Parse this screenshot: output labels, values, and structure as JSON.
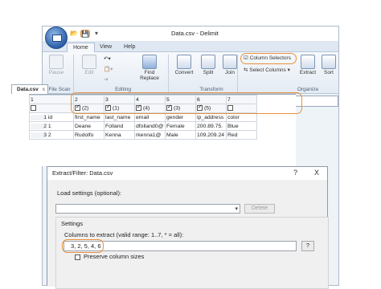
{
  "window": {
    "title": "Data.csv - Delimit"
  },
  "qat": {
    "open_icon": "folder-icon",
    "save_icon": "save-icon",
    "more": "₹"
  },
  "tabs": [
    {
      "label": "Home"
    },
    {
      "label": "View"
    },
    {
      "label": "Help"
    }
  ],
  "ribbon": {
    "file_scan": {
      "label": "File Scan",
      "pause": "Pause"
    },
    "editing": {
      "label": "Editing",
      "edit": "Edit",
      "find_replace_1": "Find",
      "find_replace_2": "Replace"
    },
    "transform": {
      "label": "Transform",
      "convert": "Convert",
      "split": "Split",
      "join": "Join"
    },
    "organize": {
      "label": "Organize",
      "column_selectors": "Column Selectors",
      "select_columns": "Select Columns",
      "extract": "Extract",
      "sort": "Sort"
    }
  },
  "doc_tab": {
    "label": "Data.csv",
    "close": "x"
  },
  "column_selectors": [
    {
      "num": "1",
      "checked": false,
      "order": ""
    },
    {
      "num": "2",
      "checked": true,
      "order": "(2)"
    },
    {
      "num": "3",
      "checked": true,
      "order": "(1)"
    },
    {
      "num": "4",
      "checked": true,
      "order": "(4)"
    },
    {
      "num": "5",
      "checked": true,
      "order": "(3)"
    },
    {
      "num": "6",
      "checked": true,
      "order": "(5)"
    },
    {
      "num": "7",
      "checked": false,
      "order": ""
    }
  ],
  "sheet": {
    "rows": [
      {
        "num": "1",
        "cells": [
          "id",
          "first_name",
          "last_name",
          "email",
          "gender",
          "ip_address",
          "color"
        ]
      },
      {
        "num": "2",
        "cells": [
          "1",
          "Deane",
          "Folland",
          "dfolland0@",
          "Female",
          "200.89.75.",
          "Blue"
        ]
      },
      {
        "num": "3",
        "cells": [
          "2",
          "Rudolfo",
          "Kenna",
          "rkenna1@",
          "Male",
          "109.209.24",
          "Red"
        ]
      }
    ]
  },
  "dialog": {
    "title": "Extract/Filter: Data.csv",
    "help": "?",
    "close": "X",
    "load_settings_label": "Load settings (optional):",
    "delete_label": "Delete",
    "settings_label": "Settings",
    "columns_label": "Columns to extract (valid range: 1..7, * = all):",
    "columns_value": "3, 2, 5, 4, 6",
    "help_button": "?",
    "preserve_label": "Preserve column sizes"
  },
  "colors": {
    "highlight": "#e8903a",
    "accent": "#2c5fa8"
  }
}
